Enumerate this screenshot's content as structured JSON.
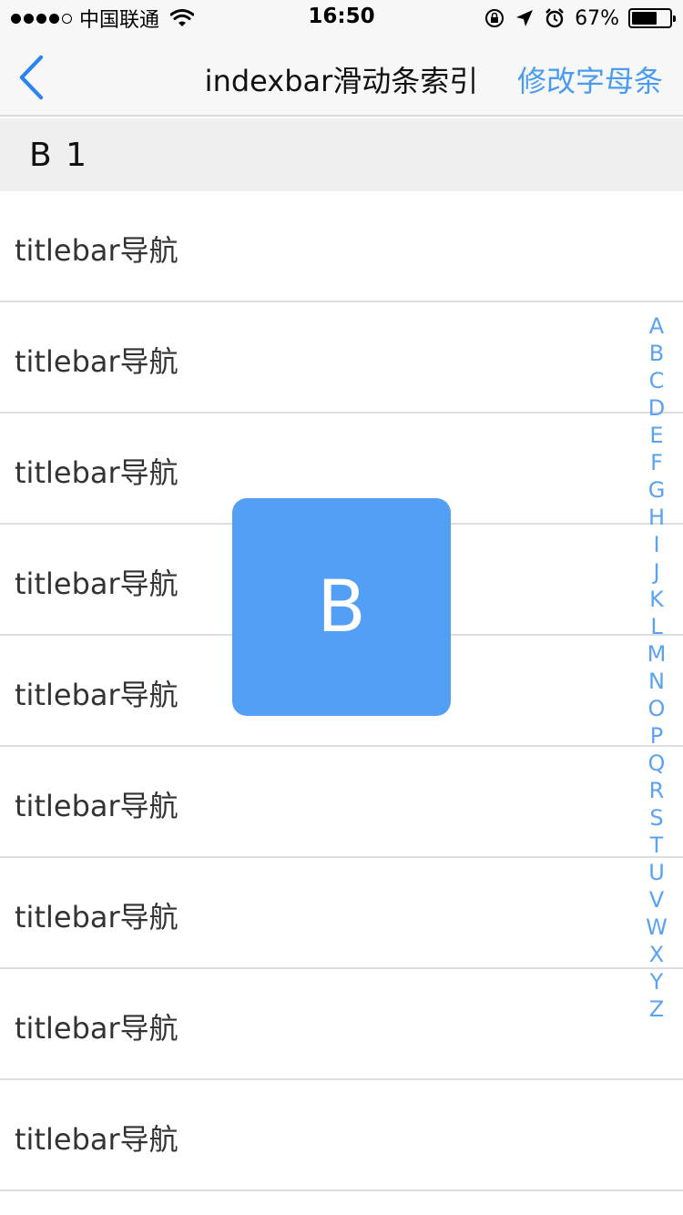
{
  "status_bar": {
    "carrier": "中国联通",
    "time": "16:50",
    "battery_percent": "67%",
    "battery_level": 0.67,
    "signal_bars_filled": 4,
    "signal_bars_total": 5,
    "icons": [
      "wifi-icon",
      "rotation-lock-icon",
      "location-arrow-icon",
      "alarm-icon",
      "battery-icon"
    ]
  },
  "nav": {
    "back_icon": "chevron-left-icon",
    "title": "indexbar滑动条索引",
    "right_action": "修改字母条",
    "accent_color": "#4a9cf0"
  },
  "section": {
    "header": "B 1"
  },
  "list": {
    "items": [
      "titlebar导航",
      "titlebar导航",
      "titlebar导航",
      "titlebar导航",
      "titlebar导航",
      "titlebar导航",
      "titlebar导航",
      "titlebar导航",
      "titlebar导航"
    ]
  },
  "index_bar": {
    "letters": [
      "A",
      "B",
      "C",
      "D",
      "E",
      "F",
      "G",
      "H",
      "I",
      "J",
      "K",
      "L",
      "M",
      "N",
      "O",
      "P",
      "Q",
      "R",
      "S",
      "T",
      "U",
      "V",
      "W",
      "X",
      "Y",
      "Z"
    ],
    "color": "#5aa2f2"
  },
  "popup": {
    "letter": "B",
    "color": "#539ff6"
  }
}
